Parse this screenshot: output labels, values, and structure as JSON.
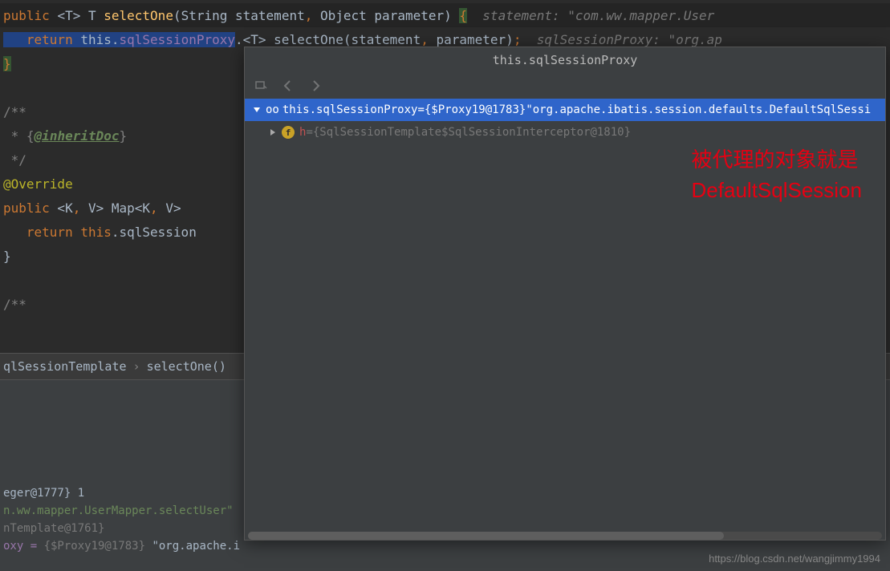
{
  "code": {
    "line1": {
      "full": "public <T> T selectOne(String statement, Object parameter) {",
      "hint": "  statement: \"com.ww.mapper.User"
    },
    "line2": {
      "prefix": "   return ",
      "call": "this.sqlSessionProxy",
      "rest": ".<T> selectOne(statement, parameter);",
      "hint": "  sqlSessionProxy: \"org.ap"
    },
    "line3": "}",
    "line5": "/**",
    "line6": " * {@inheritDoc}",
    "line7": " */",
    "line8": "@Override",
    "line9": "public <K, V> Map<K, V> ",
    "line10": "   return this.sqlSession",
    "line11": "}",
    "line13": "/**"
  },
  "breadcrumb": {
    "part1": "qlSessionTemplate",
    "part2": "selectOne()"
  },
  "debug": {
    "var1": "eger@1777} 1",
    "var2": "n.ww.mapper.UserMapper.selectUser\"",
    "var3": "nTemplate@1761}",
    "var4_prefix": "oxy = ",
    "var4_val": "{$Proxy19@1783}",
    "var4_str": " \"org.apache.ibat"
  },
  "popup": {
    "title": "this.sqlSessionProxy",
    "tree": {
      "root": {
        "prefix": "oo ",
        "label": "this.sqlSessionProxy",
        "eq": " = ",
        "value": "{$Proxy19@1783}",
        "string": " \"org.apache.ibatis.session.defaults.DefaultSqlSessi"
      },
      "child": {
        "icon": "f",
        "label": "h",
        "eq": " = ",
        "value": "{SqlSessionTemplate$SqlSessionInterceptor@1810}"
      }
    }
  },
  "annotation": {
    "line1": "被代理的对象就是",
    "line2": "DefaultSqlSession"
  },
  "watermark": "https://blog.csdn.net/wangjimmy1994"
}
